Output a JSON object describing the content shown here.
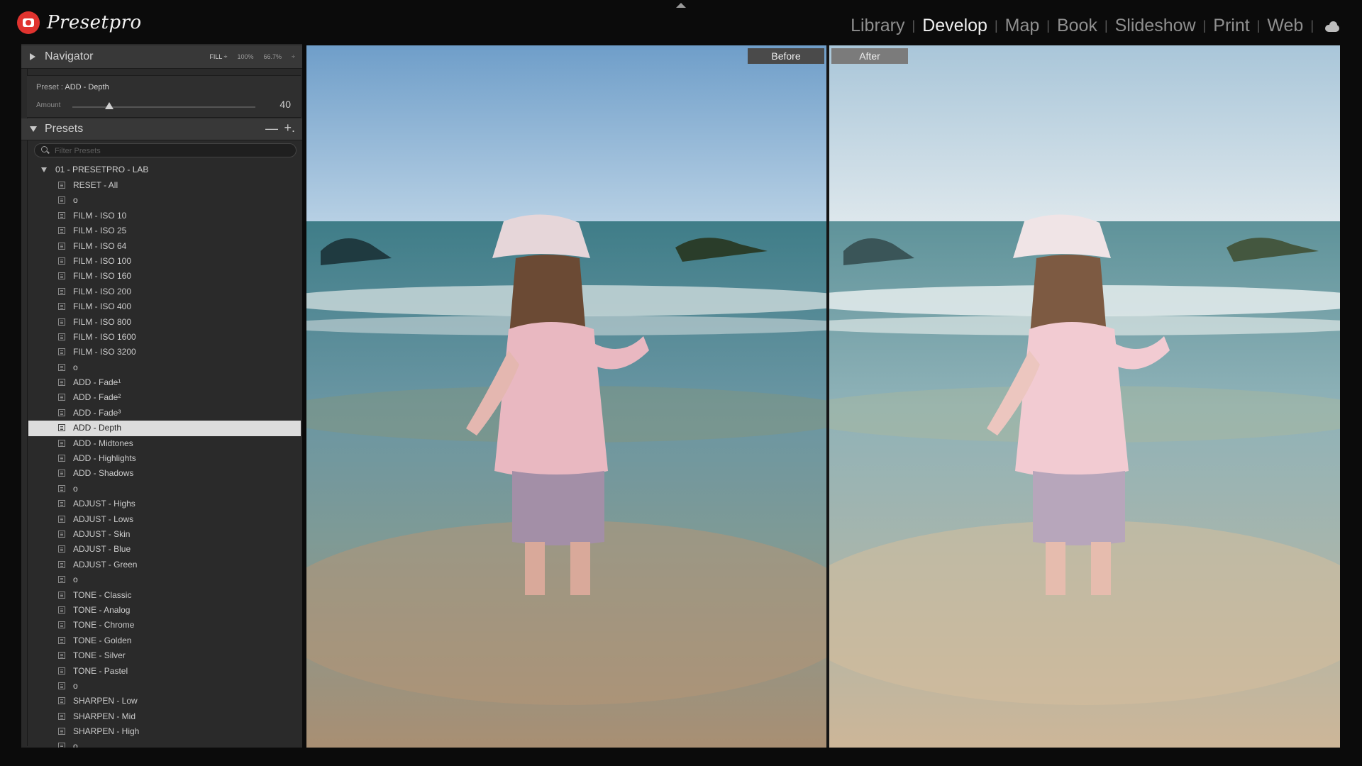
{
  "app": {
    "logo_text": "Presetpro",
    "modules": [
      {
        "label": "Library",
        "active": false
      },
      {
        "label": "Develop",
        "active": true
      },
      {
        "label": "Map",
        "active": false
      },
      {
        "label": "Book",
        "active": false
      },
      {
        "label": "Slideshow",
        "active": false
      },
      {
        "label": "Print",
        "active": false
      },
      {
        "label": "Web",
        "active": false
      }
    ],
    "module_separator": "|"
  },
  "navigator": {
    "title": "Navigator",
    "zoom_options": [
      "FILL ÷",
      "100%",
      "66.7%",
      "÷"
    ]
  },
  "preset_amount": {
    "label_prefix": "Preset : ",
    "preset_name": "ADD - Depth",
    "amount_label": "Amount",
    "amount_value": "40",
    "amount_fraction": 0.2
  },
  "presets": {
    "title": "Presets",
    "minus": "—",
    "plus": "+.",
    "filter_placeholder": "Filter Presets",
    "group_name": "01 - PRESETPRO - LAB",
    "items": [
      "RESET - All",
      "o",
      "FILM - ISO 10",
      "FILM - ISO 25",
      "FILM - ISO 64",
      "FILM - ISO 100",
      "FILM - ISO 160",
      "FILM - ISO 200",
      "FILM - ISO 400",
      "FILM - ISO 800",
      "FILM - ISO 1600",
      "FILM - ISO 3200",
      "o",
      "ADD - Fade¹",
      "ADD - Fade²",
      "ADD - Fade³",
      "ADD - Depth",
      "ADD - Midtones",
      "ADD - Highlights",
      "ADD - Shadows",
      "o",
      "ADJUST - Highs",
      "ADJUST - Lows",
      "ADJUST - Skin",
      "ADJUST - Blue",
      "ADJUST - Green",
      "o",
      "TONE - Classic",
      "TONE - Analog",
      "TONE - Chrome",
      "TONE - Golden",
      "TONE - Silver",
      "TONE - Pastel",
      "o",
      "SHARPEN - Low",
      "SHARPEN - Mid",
      "SHARPEN - High",
      "o"
    ],
    "selected_index": 16
  },
  "viewer": {
    "before_label": "Before",
    "after_label": "After"
  },
  "colors": {
    "accent_logo": "#e0332f",
    "selected_row": "#dcdcdc",
    "panel_bg": "#2a2a2a"
  }
}
